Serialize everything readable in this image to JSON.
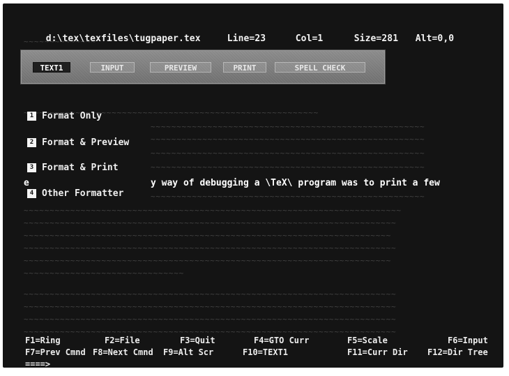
{
  "status_bar": {
    "path": "d:\\tex\\texfiles\\tugpaper.tex",
    "line": "Line=23",
    "col": "Col=1",
    "size": "Size=281",
    "alt": "Alt=0,0"
  },
  "menu_bar": {
    "tabs": [
      {
        "label": "TEXT1",
        "active": true
      },
      {
        "label": "INPUT",
        "active": false
      },
      {
        "label": "PREVIEW",
        "active": false
      },
      {
        "label": "PRINT",
        "active": false
      },
      {
        "label": "SPELL CHECK",
        "active": false
      }
    ]
  },
  "dropdown": {
    "items": [
      {
        "key": "1",
        "label": "Format Only"
      },
      {
        "key": "2",
        "label": "Format & Preview"
      },
      {
        "key": "3",
        "label": "Format & Print"
      },
      {
        "key": "4",
        "label": "Other Formatter"
      }
    ]
  },
  "editor": {
    "visible_line_prefix": "e",
    "visible_line": "y way of debugging a \\TeX\\ program was to print a few"
  },
  "function_keys": {
    "row1": [
      {
        "label": "F1=Ring"
      },
      {
        "label": "F2=File"
      },
      {
        "label": "F3=Quit"
      },
      {
        "label": "F4=GTO Curr"
      },
      {
        "label": "F5=Scale"
      },
      {
        "label": "F6=Input"
      }
    ],
    "row2": [
      {
        "label": "F7=Prev Cmnd"
      },
      {
        "label": "F8=Next Cmnd"
      },
      {
        "label": "F9=Alt Scr"
      },
      {
        "label": "F10=TEXT1"
      },
      {
        "label": "F11=Curr Dir"
      },
      {
        "label": "F12=Dir Tree"
      }
    ]
  },
  "command_prompt": "====>"
}
